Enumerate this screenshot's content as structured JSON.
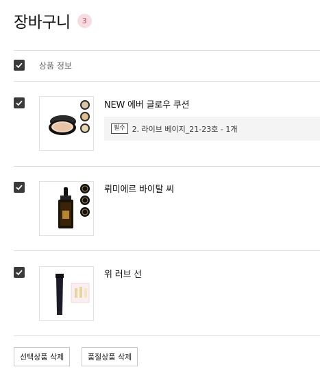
{
  "cart": {
    "title": "장바구니",
    "count": "3",
    "header_label": "상품 정보"
  },
  "items": [
    {
      "name": "NEW 에버 글로우 쿠션",
      "option_badge": "필수",
      "option_text": "2. 라이브 베이지_21-23호 - 1개",
      "checked": true,
      "icon": "cushion-compact-image"
    },
    {
      "name": "뤼미에르 바이탈 씨",
      "checked": true,
      "icon": "serum-bottle-image"
    },
    {
      "name": "위 러브 선",
      "checked": true,
      "icon": "sunscreen-tube-image"
    }
  ],
  "actions": {
    "delete_selected": "선택상품 삭제",
    "delete_soldout": "품절상품 삭제"
  },
  "colors": {
    "badge_bg": "#f6dde2",
    "badge_text": "#c0475f",
    "checkbox": "#3a3a3a"
  }
}
